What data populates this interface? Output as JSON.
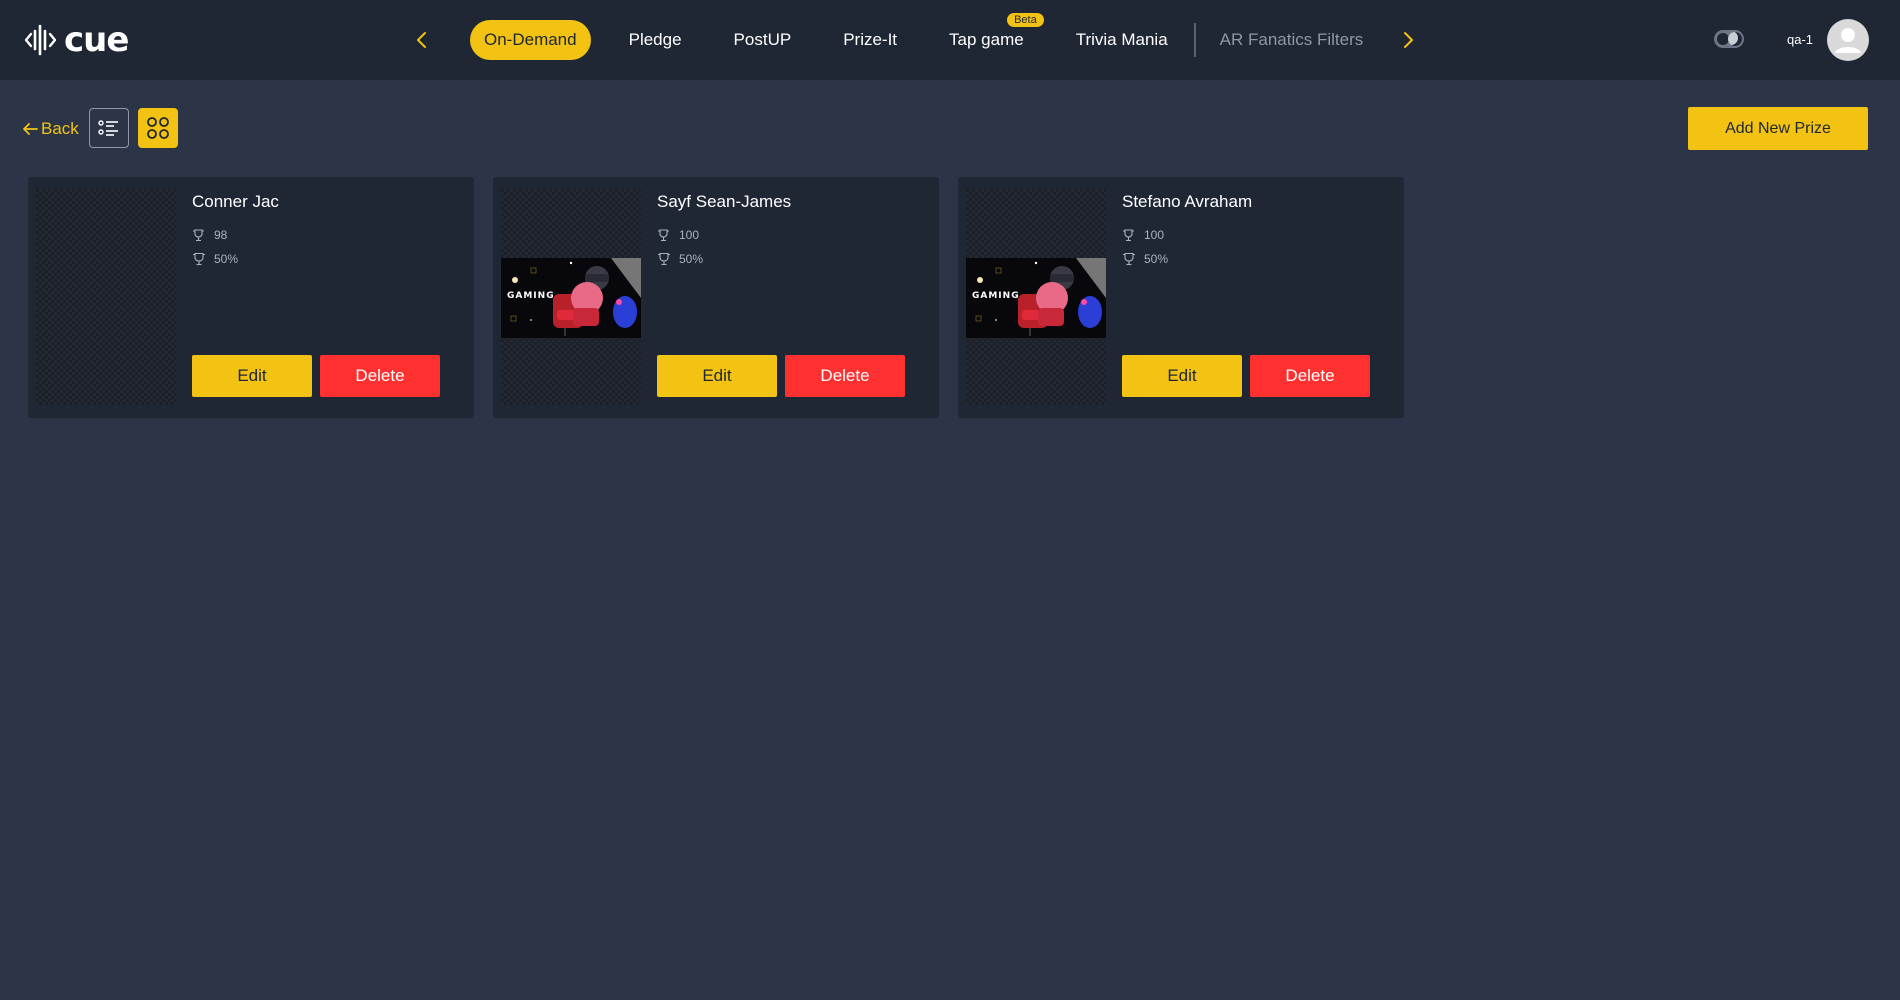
{
  "app": {
    "logo_text": "cue",
    "accent_color": "#f2c313",
    "danger_color": "#ff3030"
  },
  "nav": {
    "prev_icon": "chevron-left-icon",
    "next_icon": "chevron-right-icon",
    "tabs": [
      {
        "label": "On-Demand",
        "active": true
      },
      {
        "label": "Pledge"
      },
      {
        "label": "PostUP"
      },
      {
        "label": "Prize-It"
      },
      {
        "label": "Tap game",
        "badge": "Beta"
      },
      {
        "label": "Trivia Mania"
      },
      {
        "label": "AR Fanatics Filters",
        "muted": true
      }
    ]
  },
  "user": {
    "name": "qa-1",
    "theme_icon": "dark-mode-toggle-icon",
    "avatar_icon": "user-avatar-icon"
  },
  "toolbar": {
    "back_label": "Back",
    "list_view_icon": "list-view-icon",
    "grid_view_icon": "grid-view-icon",
    "view_mode": "grid",
    "add_label": "Add New Prize"
  },
  "cards": [
    {
      "name": "Conner Jac",
      "stat1": "98",
      "stat2": "50%",
      "has_image": false,
      "edit_label": "Edit",
      "delete_label": "Delete"
    },
    {
      "name": "Sayf Sean-James",
      "stat1": "100",
      "stat2": "50%",
      "has_image": true,
      "image_text": "GAMING",
      "edit_label": "Edit",
      "delete_label": "Delete"
    },
    {
      "name": "Stefano Avraham",
      "stat1": "100",
      "stat2": "50%",
      "has_image": true,
      "image_text": "GAMING",
      "edit_label": "Edit",
      "delete_label": "Delete"
    }
  ]
}
